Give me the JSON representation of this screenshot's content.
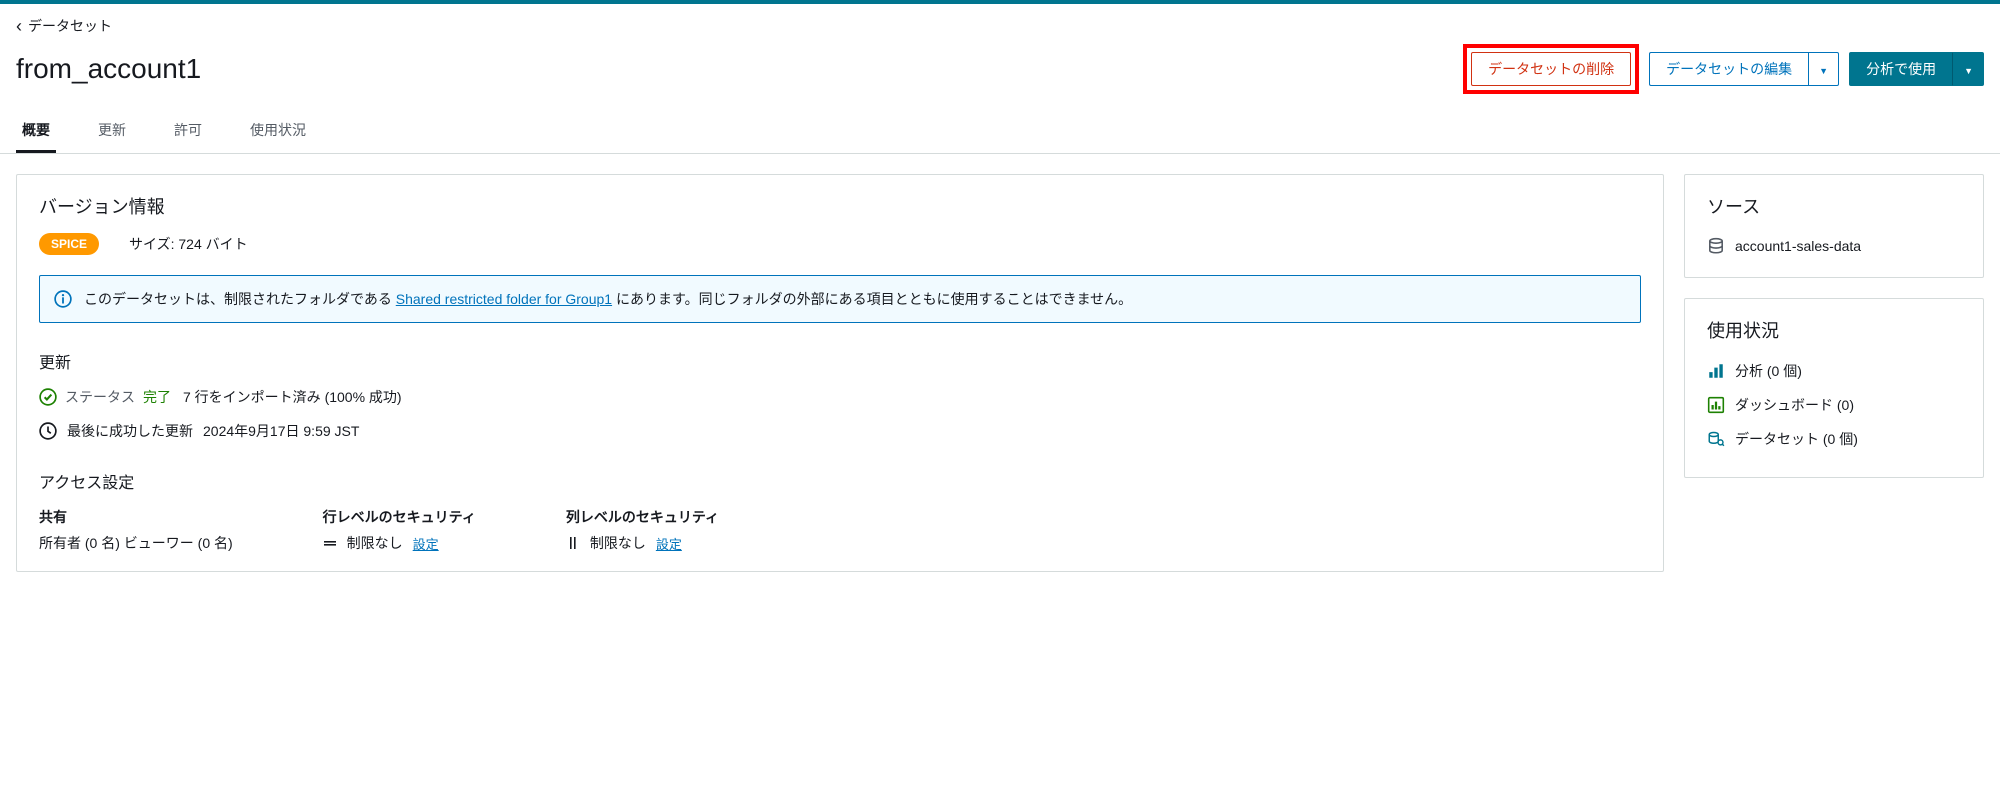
{
  "breadcrumb": {
    "label": "データセット"
  },
  "page_title": "from_account1",
  "actions": {
    "delete": "データセットの削除",
    "edit": "データセットの編集",
    "use": "分析で使用"
  },
  "tabs": [
    {
      "label": "概要",
      "active": true
    },
    {
      "label": "更新",
      "active": false
    },
    {
      "label": "許可",
      "active": false
    },
    {
      "label": "使用状況",
      "active": false
    }
  ],
  "version_panel": {
    "heading": "バージョン情報",
    "badge": "SPICE",
    "size_label": "サイズ: 724 バイト",
    "banner_prefix": "このデータセットは、制限されたフォルダである ",
    "banner_link": "Shared restricted folder for Group1",
    "banner_suffix": " にあります。同じフォルダの外部にある項目とともに使用することはできません。"
  },
  "refresh_section": {
    "heading": "更新",
    "status_label": "ステータス",
    "status_value": "完了",
    "status_detail": "7 行をインポート済み (100% 成功)",
    "last_label": "最後に成功した更新",
    "last_time": "2024年9月17日 9:59 JST"
  },
  "access_section": {
    "heading": "アクセス設定",
    "share_label": "共有",
    "share_value": "所有者 (0 名)  ビューワー (0 名)",
    "row_sec_label": "行レベルのセキュリティ",
    "row_sec_value": "制限なし",
    "col_sec_label": "列レベルのセキュリティ",
    "col_sec_value": "制限なし",
    "config_link": "設定"
  },
  "source_panel": {
    "heading": "ソース",
    "source_name": "account1-sales-data"
  },
  "usage_panel": {
    "heading": "使用状況",
    "analysis": "分析 (0 個)",
    "dashboard": "ダッシュボード (0)",
    "dataset": "データセット (0 個)"
  }
}
